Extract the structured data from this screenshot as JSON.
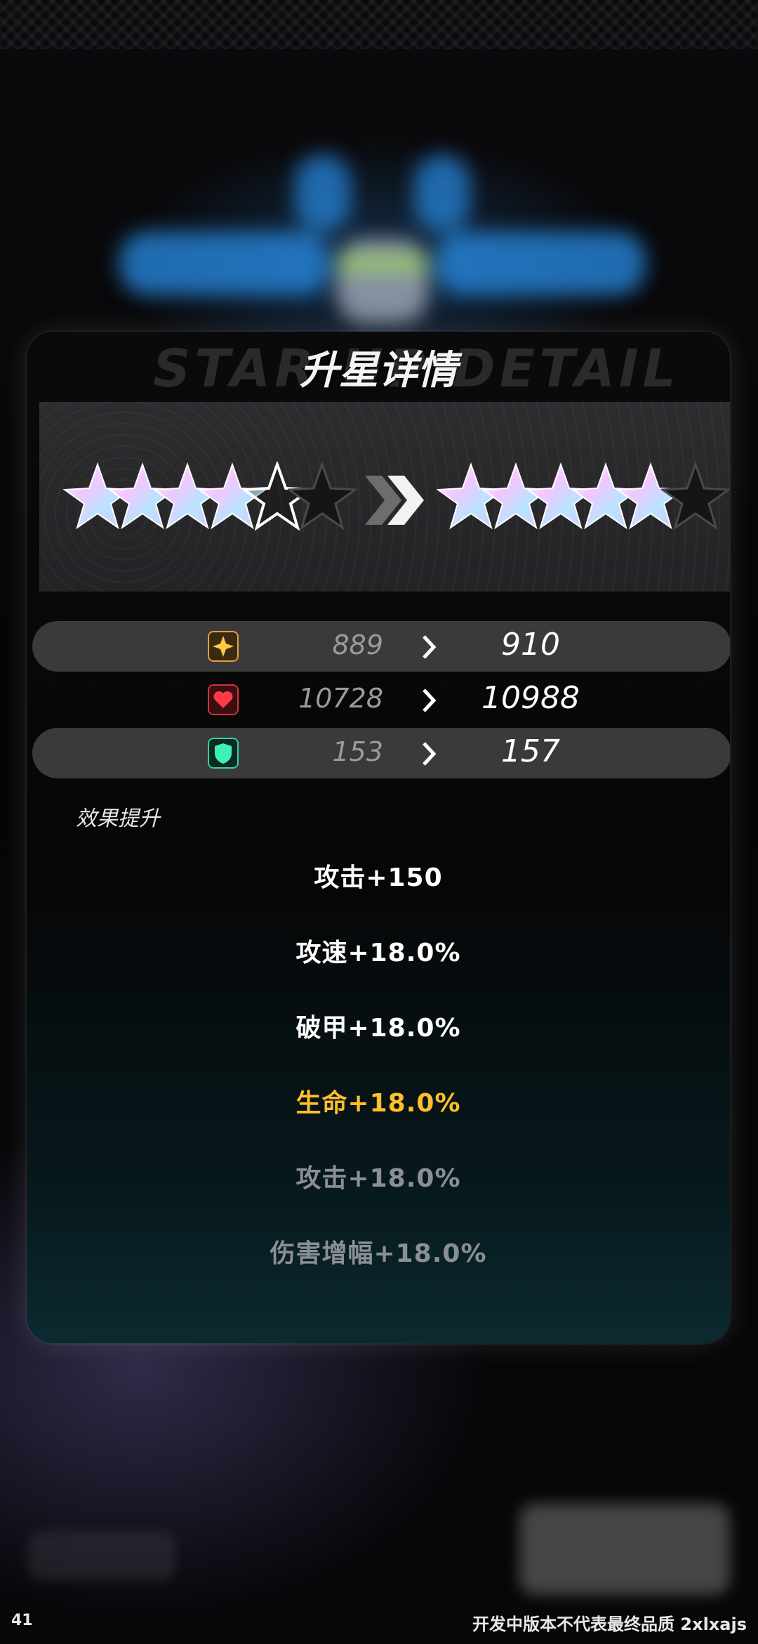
{
  "panel": {
    "title": "升星详情",
    "title_background_text": "STAR UP DETAIL"
  },
  "stars": {
    "current_level": 4,
    "next_level": 5,
    "max_stars": 6,
    "colors": {
      "filled": "#e9d8ff",
      "half": "#ffffff",
      "empty": "#151515"
    }
  },
  "stats": [
    {
      "icon": "attack-icon",
      "icon_color": "#e7a13a",
      "old": "889",
      "new": "910"
    },
    {
      "icon": "health-icon",
      "icon_color": "#d8323a",
      "old": "10728",
      "new": "10988"
    },
    {
      "icon": "defense-icon",
      "icon_color": "#2fd6a0",
      "old": "153",
      "new": "157"
    }
  ],
  "effects_label": "效果提升",
  "effects": [
    {
      "text": "攻击+150",
      "color": "#ffffff"
    },
    {
      "text": "攻速+18.0%",
      "color": "#ffffff"
    },
    {
      "text": "破甲+18.0%",
      "color": "#ffffff"
    },
    {
      "text": "生命+18.0%",
      "color": "#ffbf2a"
    },
    {
      "text": "攻击+18.0%",
      "color": "#8b8f93"
    },
    {
      "text": "伤害增幅+18.0%",
      "color": "#8b8f93"
    }
  ],
  "footer": {
    "left": "41",
    "right": "开发中版本不代表最终品质 2xlxajs"
  }
}
